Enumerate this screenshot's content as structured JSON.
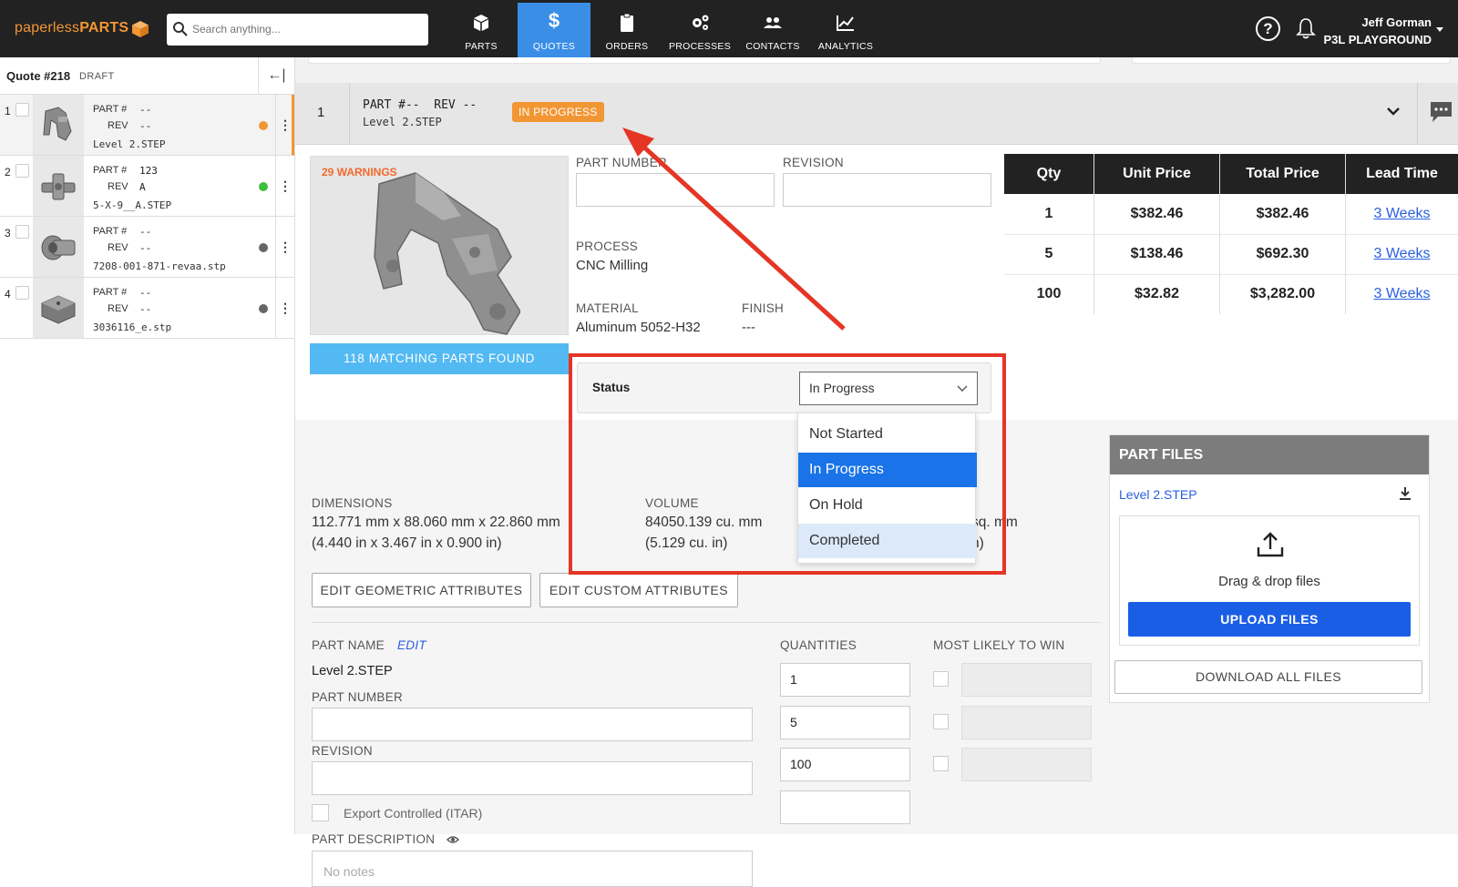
{
  "nav": {
    "logo_light": "paperless",
    "logo_bold": "PARTS",
    "search_placeholder": "Search anything...",
    "items": [
      {
        "label": "PARTS",
        "icon": "box-icon"
      },
      {
        "label": "QUOTES",
        "icon": "dollar-icon"
      },
      {
        "label": "ORDERS",
        "icon": "clipboard-icon"
      },
      {
        "label": "PROCESSES",
        "icon": "gears-icon"
      },
      {
        "label": "CONTACTS",
        "icon": "people-icon"
      },
      {
        "label": "ANALYTICS",
        "icon": "chart-icon"
      }
    ],
    "active": "QUOTES",
    "help_glyph": "?",
    "user_name": "Jeff Gorman",
    "user_org": "P3L PLAYGROUND"
  },
  "sidebar": {
    "quote_title": "Quote #218",
    "quote_status": "DRAFT",
    "collapse_glyph": "←|",
    "part_label": "PART #",
    "rev_label": "REV",
    "menu_glyph": "⋮",
    "items": [
      {
        "num": "1",
        "part": "--",
        "rev": "--",
        "file": "Level 2.STEP",
        "dot": "#f29634"
      },
      {
        "num": "2",
        "part": "123",
        "rev": "A",
        "file": "5-X-9__A.STEP",
        "dot": "#3cc03c"
      },
      {
        "num": "3",
        "part": "--",
        "rev": "--",
        "file": "7208-001-871-revaa.stp",
        "dot": "#666666"
      },
      {
        "num": "4",
        "part": "--",
        "rev": "--",
        "file": "3036116_e.stp",
        "dot": "#666666"
      }
    ]
  },
  "part_header": {
    "num": "1",
    "title": "PART #--  REV --",
    "file": "Level 2.STEP",
    "badge": "IN PROGRESS"
  },
  "part": {
    "warnings": "29 WARNINGS",
    "matching": "118 MATCHING PARTS FOUND",
    "part_number_label": "PART NUMBER",
    "revision_label": "REVISION",
    "process_label": "PROCESS",
    "process_value": "CNC Milling",
    "material_label": "MATERIAL",
    "material_value": "Aluminum 5052-H32",
    "finish_label": "FINISH",
    "finish_value": "---"
  },
  "pricing": {
    "headers": [
      "Qty",
      "Unit Price",
      "Total Price",
      "Lead Time"
    ],
    "rows": [
      {
        "qty": "1",
        "unit": "$382.46",
        "total": "$382.46",
        "lead": "3 Weeks"
      },
      {
        "qty": "5",
        "unit": "$138.46",
        "total": "$692.30",
        "lead": "3 Weeks"
      },
      {
        "qty": "100",
        "unit": "$32.82",
        "total": "$3,282.00",
        "lead": "3 Weeks"
      }
    ]
  },
  "status": {
    "label": "Status",
    "value": "In Progress",
    "options": [
      "Not Started",
      "In Progress",
      "On Hold",
      "Completed"
    ],
    "highlighted": "In Progress",
    "hovered": "Completed"
  },
  "geometry": {
    "dimensions_label": "DIMENSIONS",
    "dimensions_mm": "112.771 mm x 88.060 mm x 22.860 mm",
    "dimensions_in": "(4.440 in x 3.467 in x 0.900 in)",
    "volume_label": "VOLUME",
    "volume_mm": "84050.139 cu. mm",
    "volume_in": "(5.129 cu. in)",
    "area_mm_fragment": "sq. mm",
    "area_in_fragment": "n)",
    "edit_geometric": "EDIT GEOMETRIC ATTRIBUTES",
    "edit_custom": "EDIT CUSTOM ATTRIBUTES"
  },
  "form": {
    "part_name_label": "PART NAME",
    "edit_link": "EDIT",
    "part_name_value": "Level 2.STEP",
    "part_number_label": "PART NUMBER",
    "revision_label": "REVISION",
    "itar_label": "Export Controlled (ITAR)",
    "description_label": "PART DESCRIPTION",
    "description_placeholder": "No notes",
    "quantities_label": "QUANTITIES",
    "quantities": [
      "1",
      "5",
      "100",
      ""
    ],
    "win_label": "MOST LIKELY TO WIN"
  },
  "files": {
    "title": "PART FILES",
    "file": "Level 2.STEP",
    "drop_text": "Drag & drop files",
    "upload": "UPLOAD FILES",
    "download_all": "DOWNLOAD ALL FILES"
  },
  "colors": {
    "nav_bg": "#222222",
    "brand_orange": "#f29634",
    "active_tab": "#3a8ee6",
    "upload_blue": "#1b5ee6",
    "annotation_red": "#e53525"
  }
}
